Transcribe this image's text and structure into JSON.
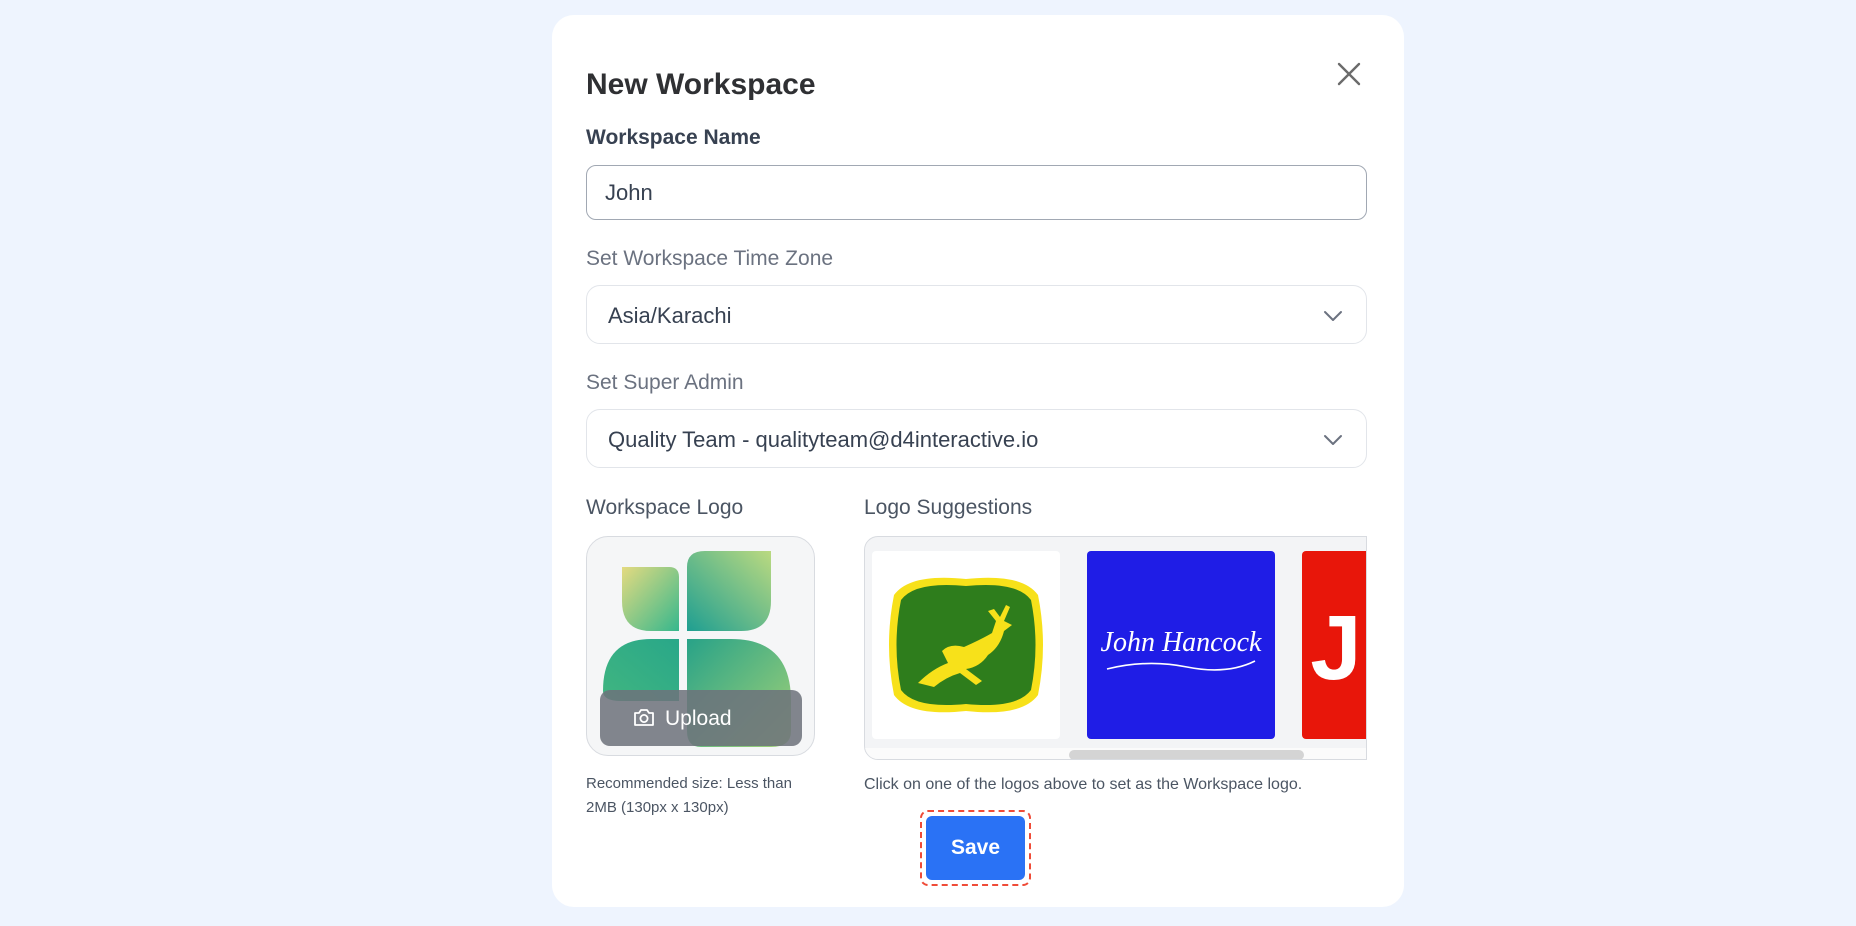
{
  "modal": {
    "title": "New Workspace",
    "close_icon": "close-icon"
  },
  "workspace_name": {
    "label": "Workspace Name",
    "value": "John"
  },
  "time_zone": {
    "label": "Set Workspace Time Zone",
    "selected": "Asia/Karachi"
  },
  "super_admin": {
    "label": "Set Super Admin",
    "selected": "Quality Team - qualityteam@d4interactive.io"
  },
  "workspace_logo": {
    "label": "Workspace Logo",
    "upload_label": "Upload",
    "upload_icon": "camera-icon",
    "hint": "Recommended size: Less than 2MB (130px x 130px)"
  },
  "logo_suggestions": {
    "label": "Logo Suggestions",
    "items": [
      {
        "name": "deer-logo",
        "bg": "#ffffff"
      },
      {
        "name": "signature-logo",
        "text": "John Hancock",
        "bg": "#1f1de6"
      },
      {
        "name": "letter-logo",
        "text": "J",
        "bg": "#e8160a"
      }
    ],
    "hint": "Click on one of the logos above to set as the Workspace logo."
  },
  "actions": {
    "save_label": "Save"
  },
  "colors": {
    "page_bg": "#eef4fe",
    "primary": "#2a72f5",
    "focus_ring": "#ef4b37"
  }
}
